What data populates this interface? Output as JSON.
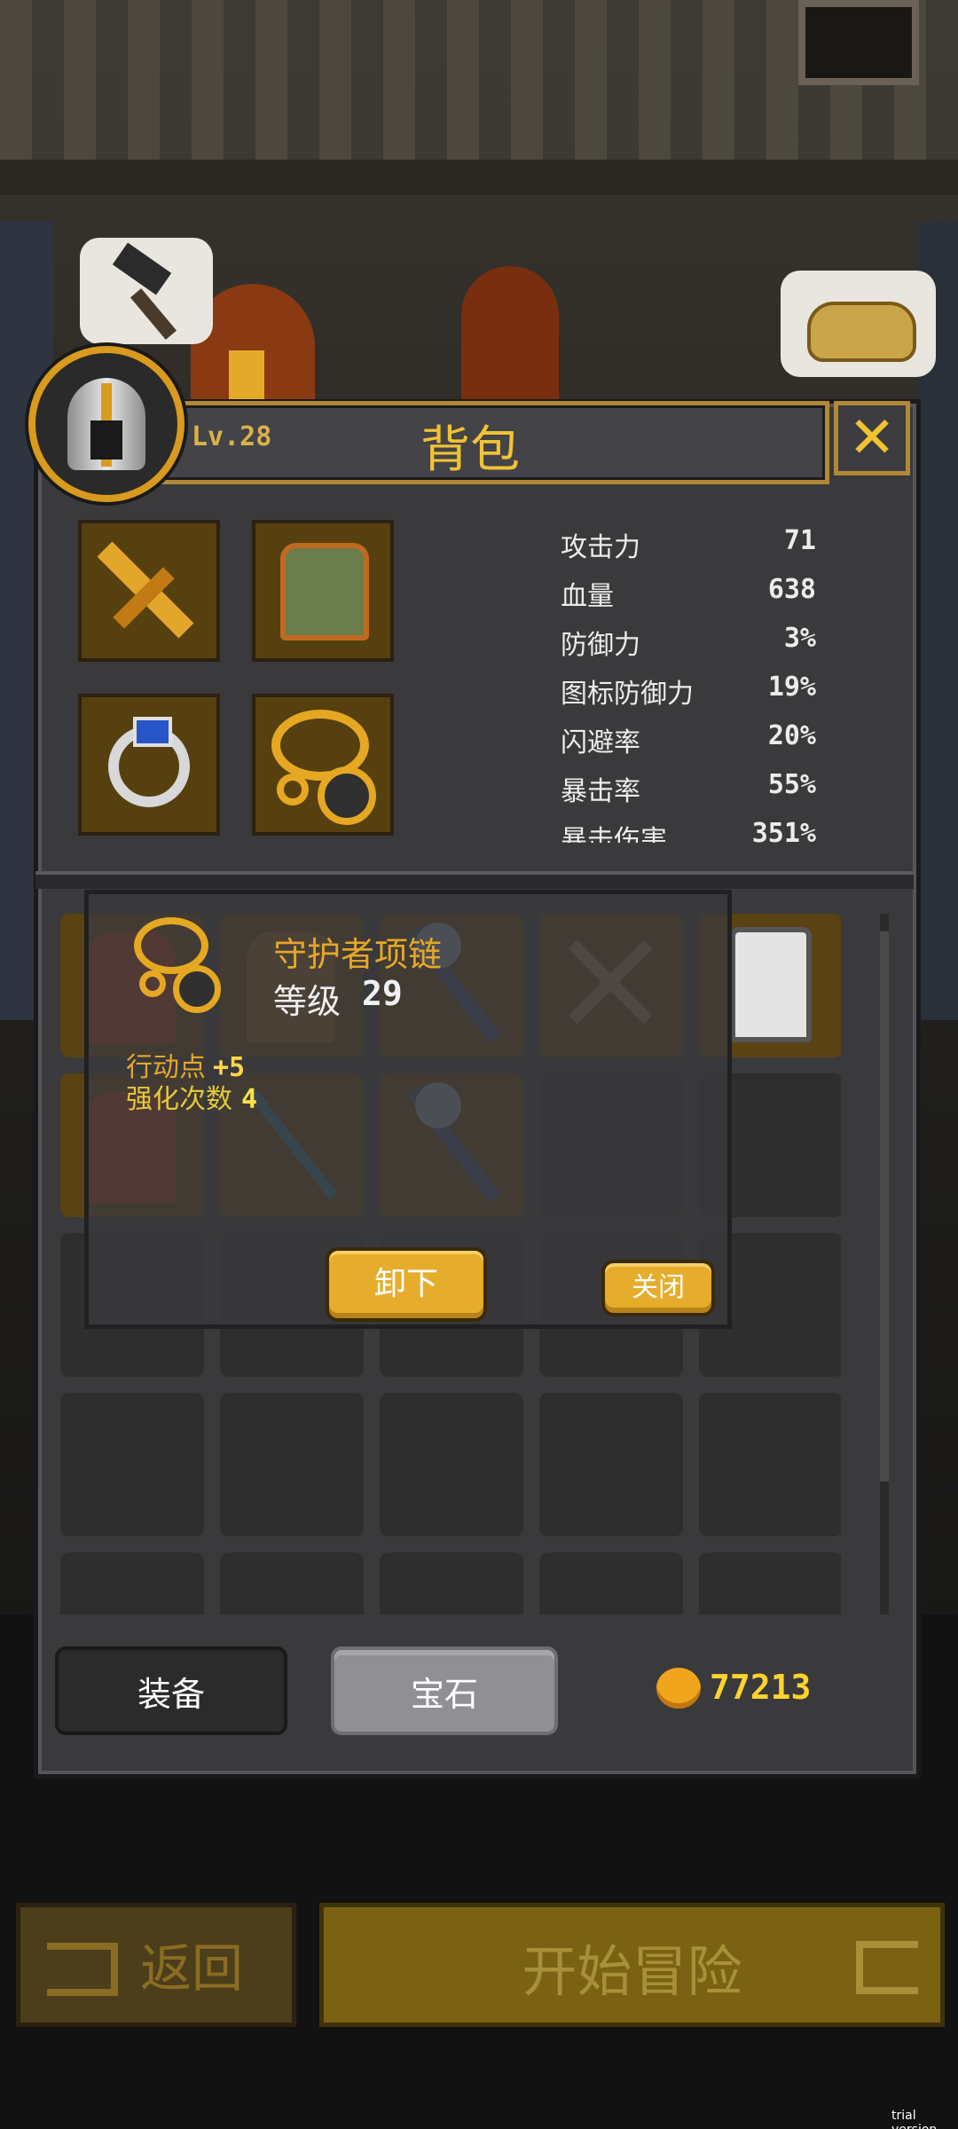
{
  "header": {
    "level": "Lv.28",
    "title": "背包",
    "close_glyph": "✕"
  },
  "stats": [
    {
      "name": "攻击力",
      "value": "71"
    },
    {
      "name": "血量",
      "value": "638"
    },
    {
      "name": "防御力",
      "value": "3%"
    },
    {
      "name": "图标防御力",
      "value": "19%"
    },
    {
      "name": "闪避率",
      "value": "20%"
    },
    {
      "name": "暴击率",
      "value": "55%"
    },
    {
      "name": "暴击伤害",
      "value": "351%"
    }
  ],
  "tooltip": {
    "item_name": "守护者项链",
    "level_label": "等级",
    "level_value": "29",
    "attr1_label": "行动点",
    "attr1_value": "+5",
    "attr2_label": "强化次数",
    "attr2_value": "4",
    "unequip_label": "卸下",
    "close_label": "关闭"
  },
  "tabs": {
    "equipment": "装备",
    "gems": "宝石"
  },
  "gold": "77213",
  "footer": {
    "back_label": "返回",
    "start_label": "开始冒险"
  },
  "watermark": "trial version",
  "colors": {
    "accent_gold": "#f1c233",
    "panel": "#3a3a3c",
    "item_slot": "#574010"
  }
}
